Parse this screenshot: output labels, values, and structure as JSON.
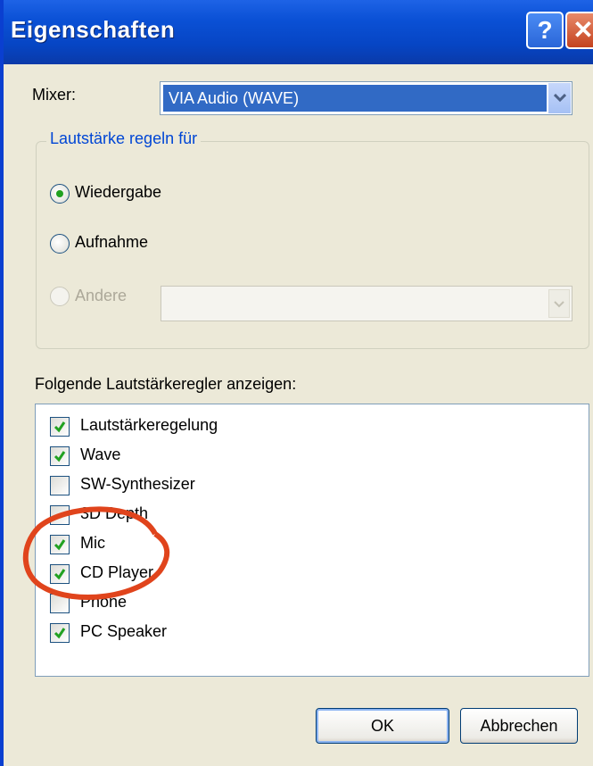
{
  "window": {
    "title": "Eigenschaften",
    "help_label": "?",
    "close_label": "✕"
  },
  "mixer": {
    "label": "Mixer:",
    "selected": "VIA Audio (WAVE)"
  },
  "volume_group": {
    "title": "Lautstärke regeln für",
    "options": [
      {
        "label": "Wiedergabe",
        "checked": true,
        "enabled": true
      },
      {
        "label": "Aufnahme",
        "checked": false,
        "enabled": true
      },
      {
        "label": "Andere",
        "checked": false,
        "enabled": false
      }
    ],
    "other_combo_value": ""
  },
  "controls_list": {
    "label": "Folgende Lautstärkeregler anzeigen:",
    "items": [
      {
        "label": "Lautstärkeregelung",
        "checked": true
      },
      {
        "label": "Wave",
        "checked": true
      },
      {
        "label": "SW-Synthesizer",
        "checked": false
      },
      {
        "label": "3D Depth",
        "checked": false
      },
      {
        "label": "Mic",
        "checked": true
      },
      {
        "label": "CD Player",
        "checked": true
      },
      {
        "label": "Phone",
        "checked": false
      },
      {
        "label": "PC Speaker",
        "checked": true
      }
    ]
  },
  "buttons": {
    "ok": "OK",
    "cancel": "Abbrechen"
  },
  "colors": {
    "titlebar": "#0a51d6",
    "selection": "#316ac5",
    "check": "#21a121",
    "annotation": "#e0441c",
    "face": "#ece9d8"
  }
}
